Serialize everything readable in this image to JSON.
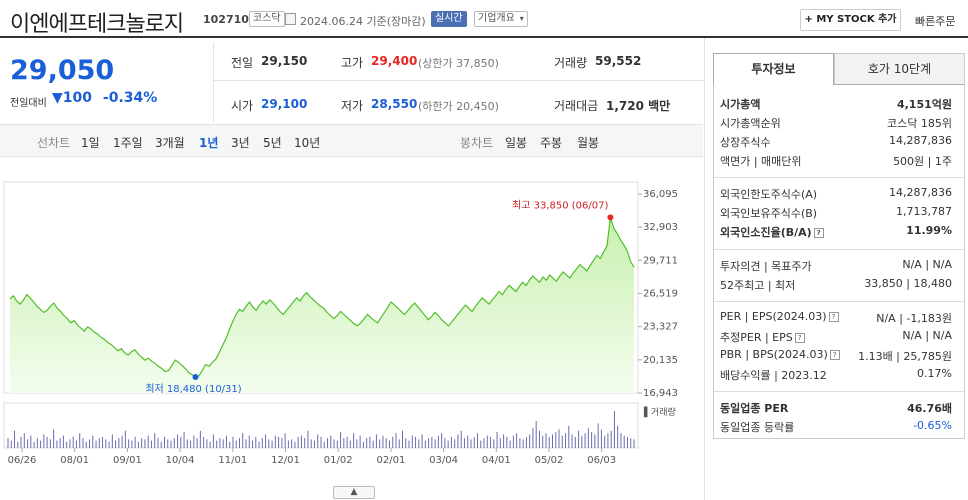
{
  "header": {
    "title": "이엔에프테크놀로지",
    "code": "102710",
    "market_badge": "코스닥",
    "date_text": "2024.06.24 기준(장마감)",
    "realtime_badge": "실시간",
    "company_badge": "기업개요",
    "mystock_label": "+ MY STOCK 추가",
    "quick_order_label": "빠른주문"
  },
  "price": {
    "current": "29,050",
    "change_label": "전일대비",
    "change_arrow": "▼",
    "change_amount": "100",
    "change_pct": "-0.34%",
    "prev_close_label": "전일",
    "prev_close": "29,150",
    "high_label": "고가",
    "high": "29,400",
    "upper_limit": "(상한가 37,850)",
    "volume_label": "거래량",
    "volume": "59,552",
    "open_label": "시가",
    "open": "29,100",
    "low_label": "저가",
    "low": "28,550",
    "lower_limit": "(하한가 20,450)",
    "value_label": "거래대금",
    "value": "1,720 백만"
  },
  "periods": {
    "line_chart_label": "선차트",
    "items": [
      "1일",
      "1주일",
      "3개월",
      "1년",
      "3년",
      "5년",
      "10년"
    ],
    "selected": "1년",
    "candle_label": "봉차트",
    "candle_items": [
      "일봉",
      "주봉",
      "월봉"
    ]
  },
  "chart_data": {
    "type": "area",
    "x_labels": [
      "06/26",
      "08/01",
      "09/01",
      "10/04",
      "11/01",
      "12/01",
      "01/02",
      "02/01",
      "03/04",
      "04/01",
      "05/02",
      "06/03"
    ],
    "y_ticks": [
      "36,095",
      "32,903",
      "29,711",
      "26,519",
      "23,327",
      "20,135",
      "16,943"
    ],
    "ylim": [
      16943,
      36095
    ],
    "values": [
      26000,
      26300,
      25800,
      25500,
      25900,
      26400,
      26100,
      25700,
      25300,
      25000,
      24700,
      24900,
      25300,
      25600,
      25100,
      24800,
      24400,
      24100,
      23700,
      23900,
      23500,
      23200,
      22900,
      23300,
      23100,
      22800,
      22600,
      22300,
      22100,
      21800,
      21600,
      21300,
      21000,
      21200,
      20800,
      20600,
      20900,
      21100,
      20700,
      20400,
      20100,
      20300,
      20000,
      19800,
      19500,
      19300,
      19000,
      19100,
      19600,
      20100,
      19900,
      19600,
      19300,
      18900,
      18700,
      18480,
      18600,
      19100,
      19700,
      19500,
      19900,
      20200,
      20800,
      21500,
      22200,
      23000,
      23800,
      24500,
      25000,
      24800,
      25300,
      25700,
      25200,
      24900,
      25400,
      25800,
      25500,
      25900,
      25600,
      25200,
      24800,
      24500,
      24900,
      25300,
      25700,
      26100,
      25800,
      26300,
      26600,
      26200,
      25900,
      25600,
      25300,
      25100,
      24700,
      24400,
      24100,
      24400,
      24800,
      24500,
      24200,
      23900,
      23600,
      23400,
      23700,
      24100,
      24500,
      24200,
      23900,
      23700,
      24200,
      24700,
      25200,
      25700,
      25400,
      25100,
      24800,
      24500,
      24900,
      25300,
      25600,
      25200,
      24800,
      24400,
      24000,
      24300,
      24700,
      24400,
      24000,
      23700,
      23400,
      23800,
      24200,
      24600,
      25000,
      25400,
      25100,
      24800,
      25300,
      25700,
      26100,
      25800,
      25500,
      25900,
      26300,
      26700,
      26400,
      26900,
      27300,
      27000,
      26700,
      27200,
      27600,
      27300,
      27800,
      28200,
      27900,
      27600,
      28100,
      27800,
      28300,
      28000,
      27700,
      28200,
      28600,
      28300,
      28000,
      28500,
      28900,
      29300,
      29000,
      28700,
      29200,
      29700,
      30200,
      29900,
      30500,
      31100,
      33850,
      32800,
      32300,
      31700,
      31200,
      30600,
      29600,
      29050
    ],
    "max_annotation": "최고 33,850 (06/07)",
    "min_annotation": "최저 18,480 (10/31)",
    "volume_label": "거래량",
    "volume_values": [
      8,
      6,
      14,
      5,
      9,
      12,
      7,
      10,
      5,
      8,
      6,
      11,
      9,
      7,
      15,
      6,
      8,
      10,
      5,
      7,
      9,
      6,
      12,
      8,
      5,
      7,
      10,
      6,
      8,
      9,
      7,
      5,
      11,
      6,
      8,
      10,
      14,
      7,
      6,
      9,
      5,
      8,
      7,
      10,
      6,
      12,
      8,
      5,
      9,
      7,
      6,
      8,
      11,
      9,
      13,
      7,
      6,
      10,
      8,
      14,
      9,
      7,
      5,
      11,
      6,
      8,
      7,
      10,
      5,
      9,
      6,
      8,
      12,
      7,
      10,
      6,
      9,
      5,
      8,
      11,
      7,
      6,
      10,
      9,
      8,
      12,
      6,
      7,
      5,
      9,
      10,
      8,
      14,
      7,
      6,
      11,
      9,
      5,
      8,
      10,
      7,
      6,
      13,
      8,
      9,
      6,
      12,
      7,
      10,
      5,
      8,
      9,
      6,
      11,
      7,
      10,
      8,
      6,
      9,
      12,
      7,
      14,
      8,
      6,
      10,
      9,
      7,
      11,
      6,
      8,
      9,
      7,
      10,
      12,
      8,
      6,
      9,
      7,
      11,
      14,
      8,
      10,
      7,
      9,
      12,
      6,
      8,
      10,
      9,
      7,
      13,
      8,
      11,
      9,
      6,
      10,
      12,
      8,
      7,
      9,
      11,
      16,
      22,
      14,
      10,
      12,
      9,
      11,
      13,
      15,
      10,
      12,
      18,
      11,
      9,
      14,
      10,
      12,
      16,
      13,
      11,
      20,
      15,
      10,
      12,
      14,
      30,
      18,
      12,
      10,
      9,
      8,
      7
    ]
  },
  "right_panel": {
    "tabs": [
      "투자정보",
      "호가 10단계"
    ],
    "rows": [
      {
        "k": "시가총액",
        "v": "4,151억원",
        "b": true
      },
      {
        "k": "시가총액순위",
        "v": "코스닥 185위"
      },
      {
        "k": "상장주식수",
        "v": "14,287,836"
      },
      {
        "k": "액면가 | 매매단위",
        "v": "500원 | 1주"
      },
      {
        "k": "외국인한도주식수(A)",
        "v": "14,287,836"
      },
      {
        "k": "외국인보유주식수(B)",
        "v": "1,713,787"
      },
      {
        "k": "외국인소진율(B/A)",
        "v": "11.99%",
        "b": true
      },
      {
        "k": "투자의견 | 목표주가",
        "v": "N/A | N/A"
      },
      {
        "k": "52주최고 | 최저",
        "v": "33,850 | 18,480"
      },
      {
        "k": "PER | EPS(2024.03)",
        "v": "N/A | -1,183원"
      },
      {
        "k": "추정PER | EPS",
        "v": "N/A | N/A"
      },
      {
        "k": "PBR | BPS(2024.03)",
        "v": "1.13배 | 25,785원"
      },
      {
        "k": "배당수익률 | 2023.12",
        "v": "0.17%"
      },
      {
        "k": "동일업종 PER",
        "v": "46.76배",
        "b": true
      },
      {
        "k": "동일업종 등락률",
        "v": "-0.65%",
        "blue": true
      }
    ]
  },
  "colors": {
    "up": "#e5261f",
    "down": "#1a5fd8",
    "chart_line": "#4fbf2a",
    "chart_fill": "#d4f5c0"
  }
}
